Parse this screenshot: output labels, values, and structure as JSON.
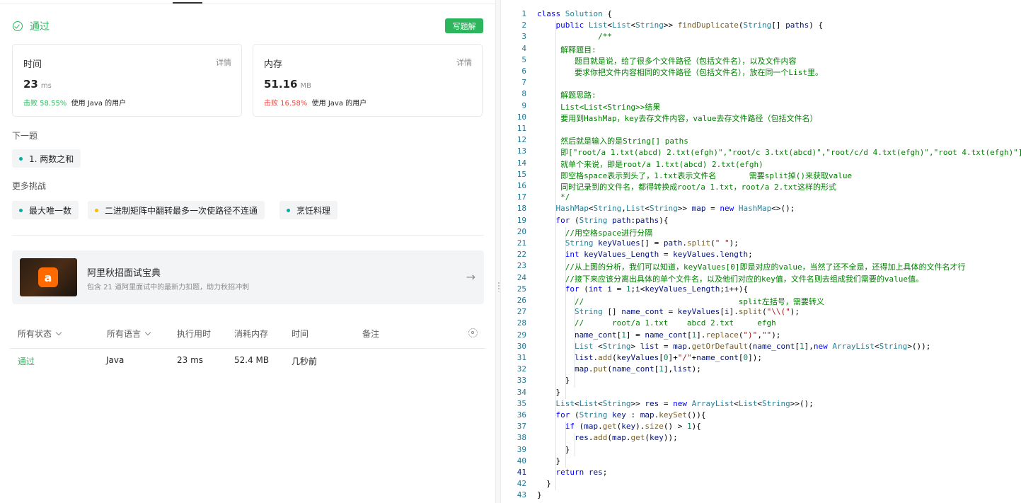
{
  "submission": {
    "status": "通过",
    "solution_button": "写题解",
    "runtime": {
      "title": "时间",
      "detail": "详情",
      "value": "23",
      "unit": "ms",
      "beat": "击败 58.55%",
      "beat_suffix": "使用 Java 的用户"
    },
    "memory": {
      "title": "内存",
      "detail": "详情",
      "value": "51.16",
      "unit": "MB",
      "beat": "击败 16.58%",
      "beat_suffix": "使用 Java 的用户"
    }
  },
  "next": {
    "label": "下一题",
    "problem": "1. 两数之和"
  },
  "more": {
    "label": "更多挑战",
    "items": [
      "最大唯一数",
      "二进制矩阵中翻转最多一次使路径不连通",
      "烹饪料理"
    ]
  },
  "promo": {
    "title": "阿里秋招面试宝典",
    "desc": "包含 21 道阿里面试中的最新力扣题，助力秋招冲刺",
    "logo_text": "a"
  },
  "table": {
    "headers": {
      "status": "所有状态",
      "language": "所有语言",
      "runtime": "执行用时",
      "memory": "消耗内存",
      "time": "时间",
      "note": "备注"
    },
    "rows": [
      {
        "status": "通过",
        "language": "Java",
        "runtime": "23 ms",
        "memory": "52.4 MB",
        "time": "几秒前",
        "note": ""
      }
    ]
  },
  "colors": {
    "accent": "#2db55d",
    "fail": "#ef4743",
    "keyword": "#0000ff",
    "type": "#267f99",
    "comment": "#008000",
    "string": "#a31515"
  },
  "code_lines": [
    "class Solution {",
    "    public List<List<String>> findDuplicate(String[] paths) {",
    "             /**",
    "     解释题目:",
    "        题目就是说，给了很多个文件路径（包括文件名），以及文件内容",
    "        要求你把文件内容相同的文件路径（包括文件名），放在同一个List里。",
    "",
    "     解题思路:",
    "     List<List<String>>结果",
    "     要用到HashMap，key去存文件内容，value去存文件路径（包括文件名）",
    "",
    "     然后就是输入的是String[] paths",
    "     即[\"root/a 1.txt(abcd) 2.txt(efgh)\",\"root/c 3.txt(abcd)\",\"root/c/d 4.txt(efgh)\",\"root 4.txt(efgh)\"]",
    "     就单个来说，即是root/a 1.txt(abcd) 2.txt(efgh)",
    "     即空格space表示到头了，1.txt表示文件名       需要split掉()来获取value",
    "     同时记录到的文件名，都得转换成root/a 1.txt，root/a 2.txt这样的形式",
    "     */",
    "    HashMap<String,List<String>> map = new HashMap<>();",
    "    for (String path:paths){",
    "      //用空格space进行分隔",
    "      String keyValues[] = path.split(\" \");",
    "      int keyValues_Length = keyValues.length;",
    "      //从上图的分析，我们可以知道，keyValues[0]即是对应的value，当然了还不全是，还得加上具体的文件名才行",
    "      //接下来应该分离出具体的单个文件名，以及他们对应的key值，文件名则去组成我们需要的value值。",
    "      for (int i = 1;i<keyValues_Length;i++){",
    "        //                                 split左括号，需要转义",
    "        String [] name_cont = keyValues[i].split(\"\\\\(\");",
    "        //      root/a 1.txt    abcd 2.txt     efgh",
    "        name_cont[1] = name_cont[1].replace(\")\",\"\");",
    "        List <String> list = map.getOrDefault(name_cont[1],new ArrayList<String>());",
    "        list.add(keyValues[0]+\"/\"+name_cont[0]);",
    "        map.put(name_cont[1],list);",
    "      }",
    "    }",
    "    List<List<String>> res = new ArrayList<List<String>>();",
    "    for (String key : map.keySet()){",
    "      if (map.get(key).size() > 1){",
    "        res.add(map.get(key));",
    "      }",
    "    }",
    "    return res;",
    "  }",
    "}"
  ]
}
